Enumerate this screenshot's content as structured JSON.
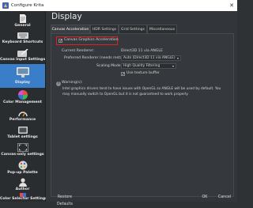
{
  "window": {
    "title": "Configure Krita",
    "close_glyph": "✕"
  },
  "sidebar": {
    "items": [
      {
        "label": "General",
        "icon": "document-icon"
      },
      {
        "label": "Keyboard Shortcuts",
        "icon": "keyboard-icon"
      },
      {
        "label": "Canvas Input Settings",
        "icon": "pen-tablet-icon"
      },
      {
        "label": "Display",
        "icon": "monitor-icon"
      },
      {
        "label": "Color Management",
        "icon": "color-wheel-icon"
      },
      {
        "label": "Performance",
        "icon": "performance-icon"
      },
      {
        "label": "Tablet settings",
        "icon": "tablet-icon"
      },
      {
        "label": "Canvas-only settings",
        "icon": "fullscreen-icon"
      },
      {
        "label": "Pop-up Palette",
        "icon": "palette-icon"
      },
      {
        "label": "Author",
        "icon": "user-icon"
      },
      {
        "label": "Color Selector Settings",
        "icon": "color-selector-icon"
      }
    ],
    "active_index": 3
  },
  "page": {
    "title": "Display",
    "tabs": [
      "Canvas Acceleration",
      "HDR Settings",
      "Grid Settings",
      "Miscellaneous"
    ],
    "active_tab": 0
  },
  "acceleration": {
    "enable_label": "Canvas Graphics Acceleration",
    "enable_checked": "✓",
    "current_renderer_label": "Current Renderer:",
    "current_renderer_value": "Direct3D 11 via ANGLE",
    "preferred_renderer_label": "Preferred Renderer (needs restart):",
    "preferred_renderer_value": "Auto (Direct3D 11 via ANGLE)",
    "scaling_mode_label": "Scaling Mode:",
    "scaling_mode_value": "High Quality Filtering",
    "texture_buffer_label": "Use texture buffer",
    "texture_buffer_checked": "✓",
    "warning_title": "Warning(s):",
    "warning_line1": "Intel graphics drivers tend to have issues with OpenGL so ANGLE will be used by default. You",
    "warning_line2": "may manually switch to OpenGL but it is not guaranteed to work properly."
  },
  "footer": {
    "restore": "Restore Defaults",
    "ok": "OK",
    "cancel": "Cancel"
  }
}
